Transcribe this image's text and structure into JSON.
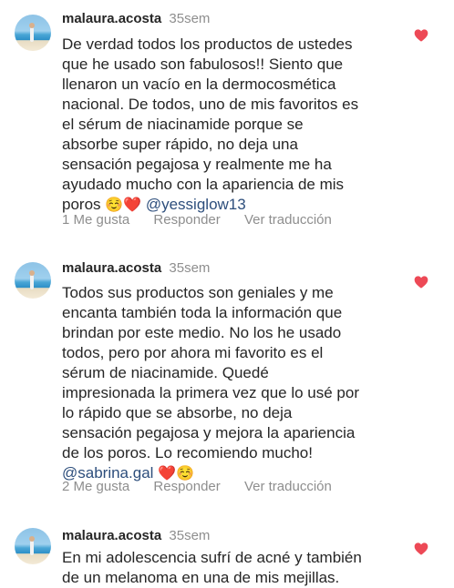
{
  "comments": [
    {
      "username": "malaura.acosta",
      "time": "35sem",
      "lines": [
        "De verdad todos los productos de ustedes",
        "que he usado son fabulosos!! Siento que",
        "llenaron un vacío en la dermocosmética",
        "nacional. De todos, uno de mis favoritos es",
        "el sérum de niacinamide porque se",
        "absorbe super rápido, no deja una",
        "sensación pegajosa y realmente me ha",
        "ayudado mucho con la apariencia de mis"
      ],
      "last_line_text": "poros",
      "emoji1": "☺️",
      "emoji2": "❤️",
      "mention": "@yessiglow13",
      "likes": "1 Me gusta",
      "reply": "Responder",
      "translate": "Ver traducción"
    },
    {
      "username": "malaura.acosta",
      "time": "35sem",
      "lines": [
        "Todos sus productos son geniales y me",
        "encanta también toda la información que",
        "brindan por este medio. No los he usado",
        "todos, pero por ahora mi favorito es el",
        "sérum de niacinamide. Quedé",
        "impresionada la primera vez que lo usé por",
        "lo rápido que se absorbe, no deja",
        "sensación pegajosa y mejora la apariencia",
        "de los poros. Lo recomiendo mucho!"
      ],
      "mention": "@sabrina.gal",
      "emoji1": "❤️",
      "emoji2": "☺️",
      "likes": "2 Me gusta",
      "reply": "Responder",
      "translate": "Ver traducción"
    },
    {
      "username": "malaura.acosta",
      "time": "35sem",
      "lines": [
        "En mi adolescencia sufrí de acné y también",
        "de un melanoma en una de mis mejillas."
      ]
    }
  ],
  "colors": {
    "like_heart": "#ed4956",
    "mention": "#2d4e7c",
    "secondary_text": "#8e8e8e"
  }
}
